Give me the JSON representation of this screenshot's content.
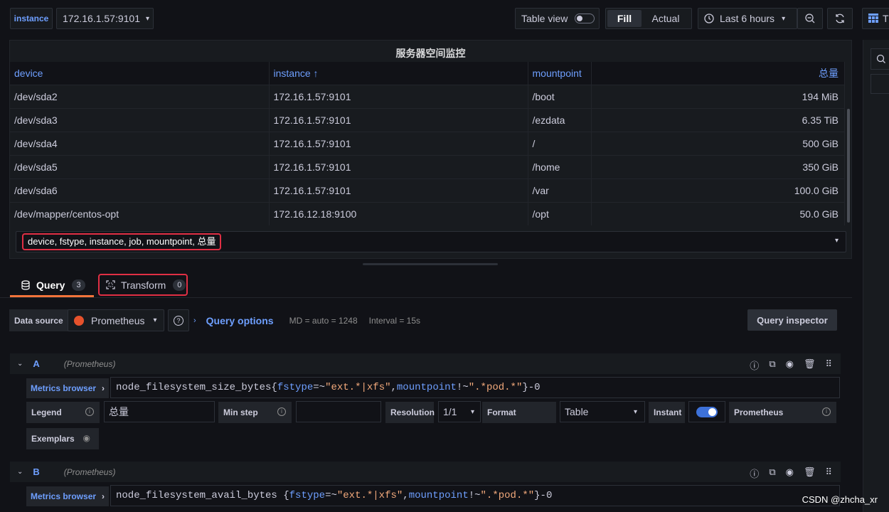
{
  "toolbar": {
    "variable_label": "instance",
    "variable_value": "172.16.1.57:9101",
    "table_view_label": "Table view",
    "fill_label": "Fill",
    "actual_label": "Actual",
    "time_range": "Last 6 hours",
    "viz_label": "T"
  },
  "panel": {
    "title": "服务器空间监控",
    "columns": [
      "device",
      "instance ↑",
      "mountpoint",
      "总量"
    ],
    "rows": [
      [
        "/dev/sda2",
        "172.16.1.57:9101",
        "/boot",
        "194 MiB"
      ],
      [
        "/dev/sda3",
        "172.16.1.57:9101",
        "/ezdata",
        "6.35 TiB"
      ],
      [
        "/dev/sda4",
        "172.16.1.57:9101",
        "/",
        "500 GiB"
      ],
      [
        "/dev/sda5",
        "172.16.1.57:9101",
        "/home",
        "350 GiB"
      ],
      [
        "/dev/sda6",
        "172.16.1.57:9101",
        "/var",
        "100.0 GiB"
      ],
      [
        "/dev/mapper/centos-opt",
        "172.16.12.18:9100",
        "/opt",
        "50.0 GiB"
      ]
    ],
    "field_select": "device, fstype, instance, job, mountpoint, 总量"
  },
  "tabs": {
    "query_label": "Query",
    "query_count": "3",
    "transform_label": "Transform",
    "transform_count": "0"
  },
  "datasource": {
    "label": "Data source",
    "value": "Prometheus",
    "query_options": "Query options",
    "md": "MD = auto = 1248",
    "interval": "Interval = 15s",
    "inspector": "Query inspector"
  },
  "queries": [
    {
      "ref": "A",
      "ds": "(Prometheus)",
      "metrics_browser": "Metrics browser",
      "expr_metric": "node_filesystem_size_bytes{",
      "expr_k1": "fstype",
      "expr_op1": "=~",
      "expr_v1": "\"ext.*|xfs\"",
      "expr_sep": ",",
      "expr_k2": "mountpoint",
      "expr_op2": " !~",
      "expr_v2": "\".*pod.*\"",
      "expr_tail": "}-0",
      "legend_label": "Legend",
      "legend_value": "总量",
      "minstep_label": "Min step",
      "minstep_value": "",
      "resolution_label": "Resolution",
      "resolution_value": "1/1",
      "format_label": "Format",
      "format_value": "Table",
      "instant_label": "Instant",
      "type_label": "Prometheus",
      "exemplars_label": "Exemplars"
    },
    {
      "ref": "B",
      "ds": "(Prometheus)",
      "metrics_browser": "Metrics browser",
      "expr_metric": "node_filesystem_avail_bytes {",
      "expr_k1": "fstype",
      "expr_op1": "=~",
      "expr_v1": "\"ext.*|xfs\"",
      "expr_sep": ",",
      "expr_k2": "mountpoint",
      "expr_op2": " !~",
      "expr_v2": "\".*pod.*\"",
      "expr_tail": "}-0"
    }
  ],
  "watermark": "CSDN @zhcha_xr",
  "colors": {
    "accent": "#6e9fff",
    "active_tab": "#f2743b",
    "highlight_box": "#e02f44",
    "prometheus": "#e6522c"
  }
}
